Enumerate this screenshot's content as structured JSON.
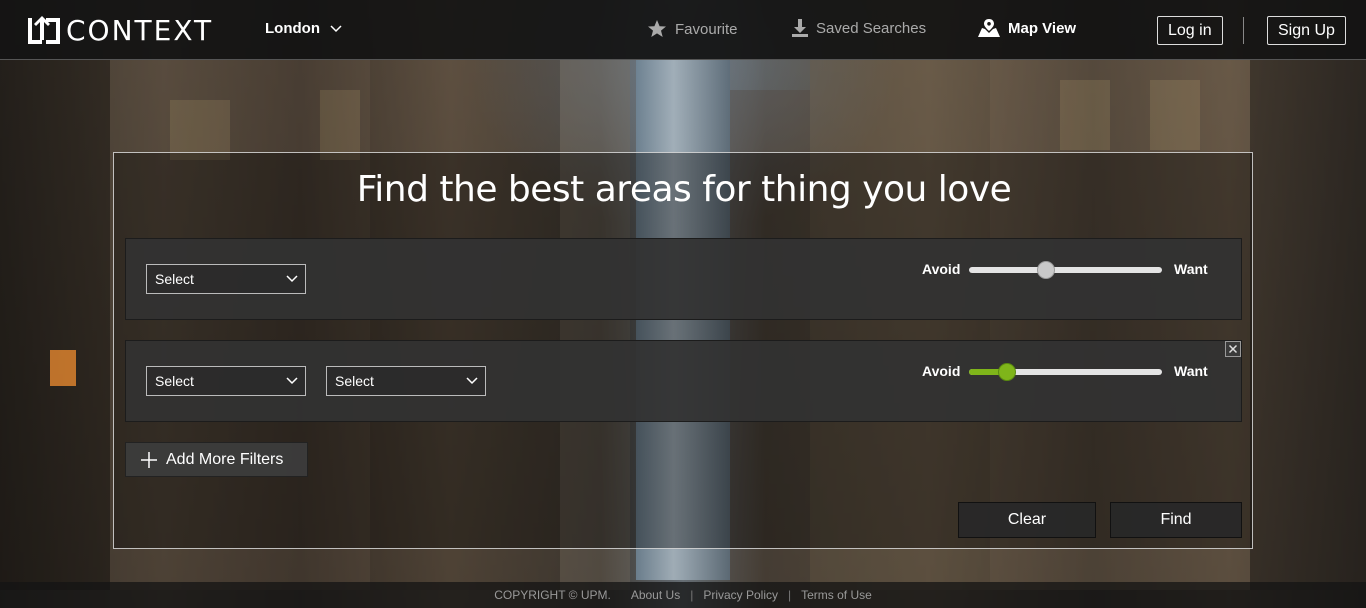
{
  "brand": {
    "name": "CONTEXT"
  },
  "nav": {
    "city": "London",
    "favourite": "Favourite",
    "saved_searches": "Saved Searches",
    "map_view": "Map View",
    "login": "Log in",
    "signup": "Sign Up"
  },
  "main": {
    "headline": "Find the best areas for thing you love",
    "filters": [
      {
        "selects": [
          "Select"
        ],
        "slider": {
          "min_label": "Avoid",
          "max_label": "Want",
          "value": 0.4
        }
      },
      {
        "selects": [
          "Select",
          "Select"
        ],
        "slider": {
          "min_label": "Avoid",
          "max_label": "Want",
          "value": 0.2
        }
      }
    ],
    "add_filters": "Add More Filters",
    "clear": "Clear",
    "find": "Find"
  },
  "footer": {
    "copyright": "COPYRIGHT © UPM.",
    "about": "About Us",
    "privacy": "Privacy Policy",
    "terms": "Terms of Use"
  },
  "colors": {
    "accent_green": "#7fb51a",
    "navbar_bg": "#121212"
  },
  "icons": [
    "logo-icon",
    "chevron-down-icon",
    "star-icon",
    "download-icon",
    "map-icon",
    "plus-icon",
    "close-icon"
  ]
}
